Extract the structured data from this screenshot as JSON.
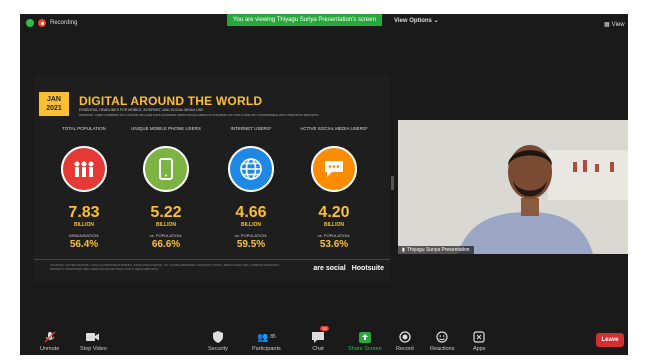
{
  "topbar": {
    "recording_label": "Recording",
    "viewing_banner": "You are viewing Thiyagu Suriya Presentation's screen",
    "view_options": "View Options",
    "view_button": "View"
  },
  "slide": {
    "badge_line1": "JAN",
    "badge_line2": "2021",
    "title": "DIGITAL AROUND THE WORLD",
    "subtitle": "ESSENTIAL HEADLINES FOR MOBILE, INTERNET, AND SOCIAL MEDIA USE",
    "subtitle2": "WARNING: USER NUMBERS NO LONGER INCLUDE DATA SOURCED FROM SOCIAL MEDIA PLATFORMS' AD TOOLS ARE NOT COMPARABLE WITH PREVIOUS REPORTS",
    "columns": [
      {
        "label": "TOTAL POPULATION",
        "value": "7.83",
        "unit": "BILLION",
        "sub_label": "URBANISATION:",
        "pct": "56.4%",
        "color": "#e53935"
      },
      {
        "label": "UNIQUE MOBILE PHONE USERS",
        "value": "5.22",
        "unit": "BILLION",
        "sub_label": "vs. POPULATION:",
        "pct": "66.6%",
        "color": "#7cb342"
      },
      {
        "label": "INTERNET USERS*",
        "value": "4.66",
        "unit": "BILLION",
        "sub_label": "vs. POPULATION:",
        "pct": "59.5%",
        "color": "#1e88e5"
      },
      {
        "label": "ACTIVE SOCIAL MEDIA USERS*",
        "value": "4.20",
        "unit": "BILLION",
        "sub_label": "vs. POPULATION:",
        "pct": "53.6%",
        "color": "#fb8c00"
      }
    ],
    "footnote": "SOURCES: UNITED NATIONS; LOCAL GOVERNMENT BODIES; GSMA INTELLIGENCE; ITU; GLOBALWEBINDEX; EUROSTAT; CNNIC; KEPIOS ANALYSIS; COMPANY EARNINGS REPORTS; OPERATORS' SELF-SERVICE ADVERTISING TOOLS; MEDIA REPORTS.",
    "logo_as": "are social",
    "logo_hs": "Hootsuite"
  },
  "video": {
    "participant_name": "Thiyagu Suriya Presentation"
  },
  "controls": {
    "unmute": "Unmute",
    "stop_video": "Stop Video",
    "security": "Security",
    "participants": "Participants",
    "participants_count": "85",
    "chat": "Chat",
    "chat_badge": "10",
    "share_screen": "Share Screen",
    "record": "Record",
    "reactions": "Reactions",
    "apps": "Apps",
    "leave": "Leave"
  },
  "colors": {
    "accent_yellow": "#fbc02d",
    "banner_green": "#27a83c",
    "leave_red": "#d32f2f"
  }
}
